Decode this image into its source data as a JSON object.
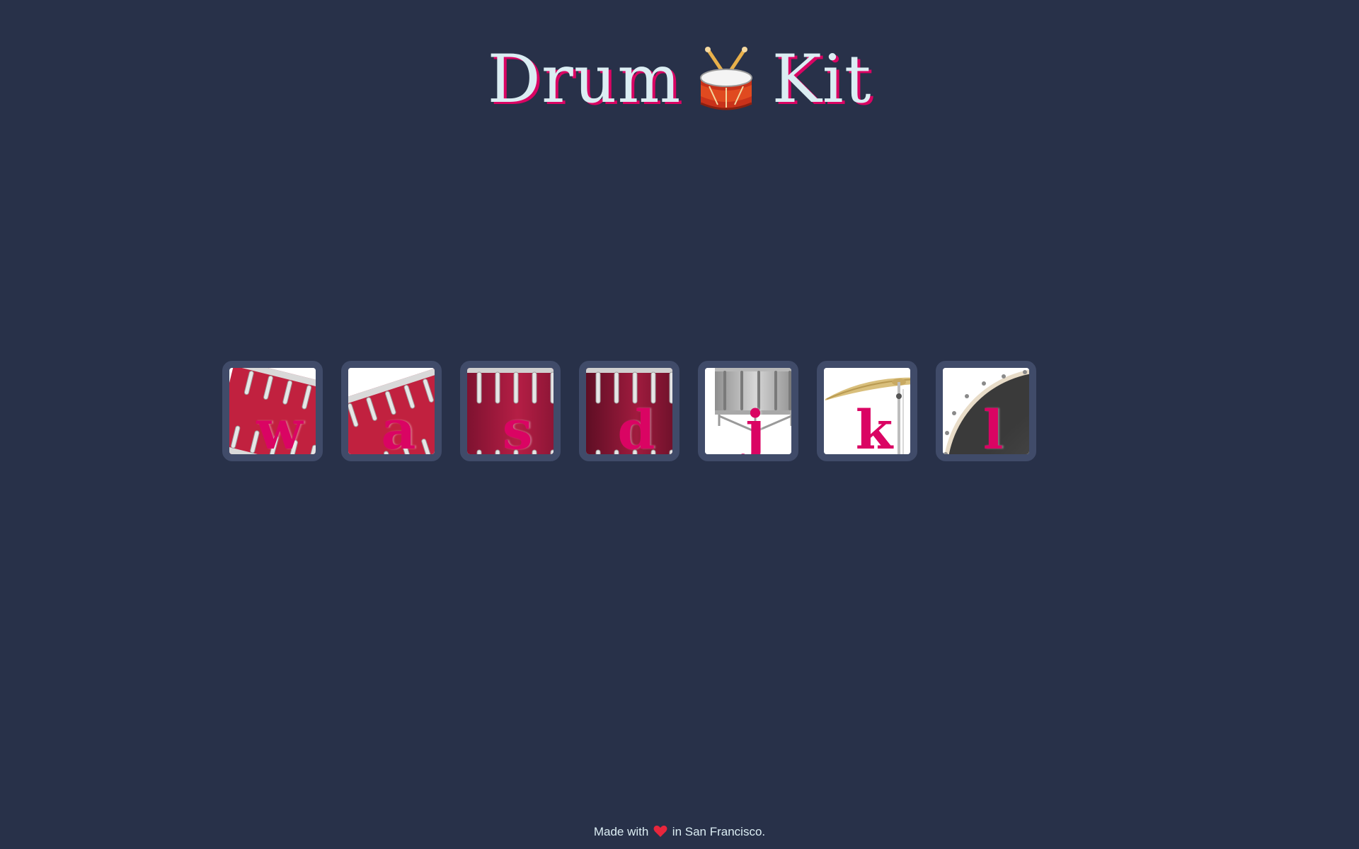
{
  "title": {
    "before": "Drum",
    "after": "Kit",
    "emoji_icon": "drum-with-sticks-icon"
  },
  "drums": [
    {
      "key": "w",
      "icon": "tom-1-icon"
    },
    {
      "key": "a",
      "icon": "tom-2-icon"
    },
    {
      "key": "s",
      "icon": "tom-3-icon"
    },
    {
      "key": "d",
      "icon": "tom-4-icon"
    },
    {
      "key": "j",
      "icon": "snare-icon"
    },
    {
      "key": "k",
      "icon": "crash-cymbal-icon"
    },
    {
      "key": "l",
      "icon": "kick-drum-icon"
    }
  ],
  "footer": {
    "before": "Made with",
    "after": "in San Francisco."
  },
  "colors": {
    "background": "#283149",
    "drum_border": "#404B69",
    "accent": "#DA0463",
    "title_text": "#DBEDF3"
  }
}
